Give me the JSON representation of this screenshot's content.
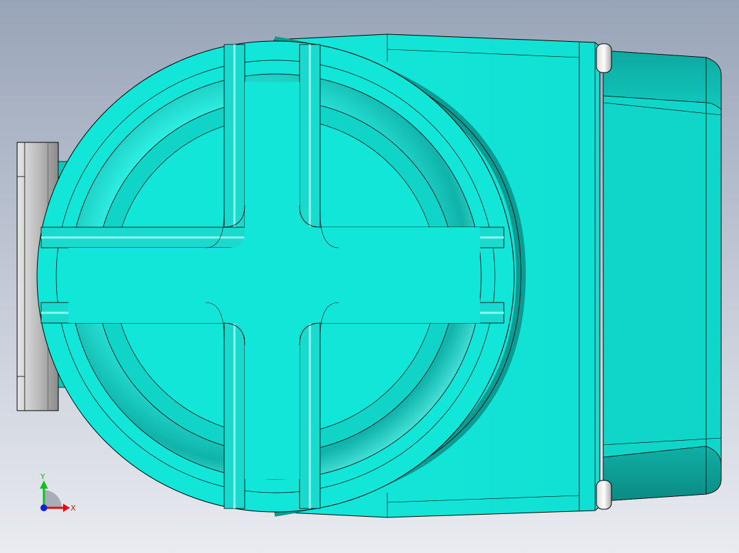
{
  "viewport": {
    "background_top": "#98a4b8",
    "background_bottom": "#e9ebf0"
  },
  "model": {
    "body_color": "#12e6d8",
    "edge_color": "#000000",
    "flange_color": "#c8c8c8"
  },
  "triad": {
    "x_label": "X",
    "y_label": "Y",
    "x_color": "#e01010",
    "y_color": "#10c020",
    "z_color": "#1020e0"
  }
}
